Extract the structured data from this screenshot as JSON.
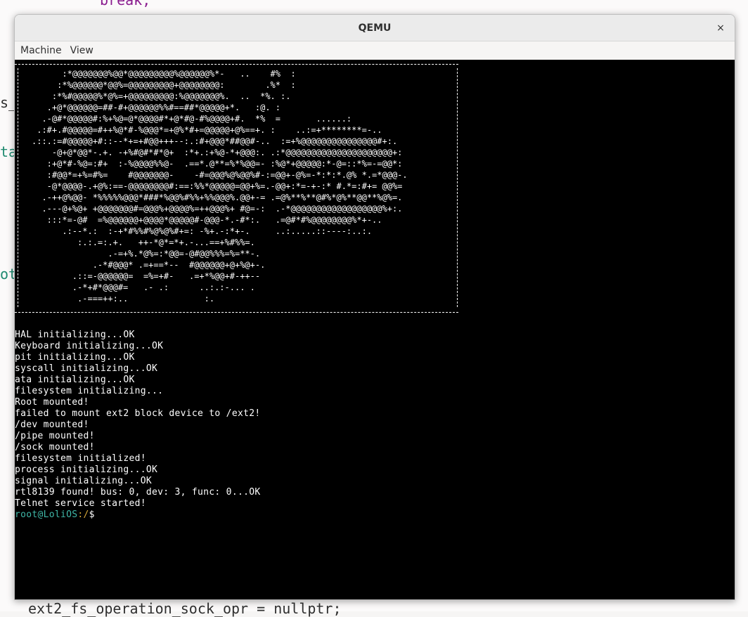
{
  "background": {
    "lines": [
      {
        "text": "break;",
        "cls": "bg-kw"
      },
      {
        "text": "s_",
        "cls": ""
      },
      {
        "text": "ta",
        "cls": "bg-teal"
      },
      {
        "text": "ot",
        "cls": "bg-teal"
      },
      {
        "text": "ext2_fs_operation_sock_opr = nullptr;",
        "cls": ""
      }
    ]
  },
  "window": {
    "title": "QEMU",
    "close_label": "×"
  },
  "menu": [
    {
      "label": "Machine"
    },
    {
      "label": "View"
    }
  ],
  "terminal": {
    "art": [
      "      :*@@@@@@@%@@*@@@@@@@@@%@@@@@@%*-   ..    #%  :",
      "     :*%@@@@@@*@@%=@@@@@@@@@+@@@@@@@@:        .%*  :",
      "    :*%#@@@@@%*@%=+@@@@@@@@@:%@@@@@@@%.  ..  *%. :.",
      "   .+@*@@@@@@=##-#+@@@@@@%%#==##*@@@@@+*.   :@. :",
      "  .-@#*@@@@@#:%+%@=@*@@@@#*+@*#@-#%@@@@+#.  *%  =       ......:",
      " .:#+.#@@@@@=#++%@*#-%@@@*=+@%*#+=@@@@@+@%==+. :    ..:=+********=-..",
      ".::.:=#@@@@@+#::--*+=+#@@+++--:.:#+@@@*##@@#-..  :=+%@@@@@@@@@@@@@@@#+:.",
      "    -@+@*@@*-.+. -+%#@#*#*@+  :*+.:+%@-*+@@@:. .:*@@@@@@@@@@@@@@@@@@@@@+:",
      "   :+@*#-%@=:#+  :-%@@@@%%@-  .==*.@**=%*%@@=- :%@*+@@@@@:*-@=::*%=-=@@*:",
      "   :#@@*=+%=#%=    #@@@@@@@-    -#=@@@%@%@@%#-:=@@+-@%=-*:*:*.@% *.=*@@@-.",
      "   -@*@@@@-.+@%:==-@@@@@@@@#:==:%%*@@@@@=@@+%=.-@@+:*=-+-:* #.*=:#+= @@%=",
      "  .-++@%@@- *%%%%%@@@*###*%@@%#%%+%%@@@%.@@+-= .=@%**%**@#%*@%**@@**%@%=.",
      "  .---@+%@+ +@@@@@@@#=@@@%+@@@@%=++@@@%+ #@=-:  .-*@@@@@@@@@@@@@@@@@@%+:.",
      "   :::*=-@#  =%@@@@@@+@@@@*@@@@@#-@@@-*.-#*:.   .=@#*#%@@@@@@@@%*+-..",
      "      .:--*.:  :-+*#%%#%@%@%#+=: -%+.-:*+-.     ..:.....::----:..:.",
      "         :.:.=:.+.   ++-*@*=*+.-...==+%#%%=.",
      "               .-=+%.*@%=:*@@=-@#@@%%%=%=**-.",
      "            .-*#@@@* .=+==*--  #@@@@@@+@+%@+-.",
      "        .::=-@@@@@@=  =%=+#-   .=+*%@@+#-++--",
      "        .-*+#*@@@#=   .- .:      ..:.:-... .",
      "         .-===++:..               :."
    ],
    "log": [
      "HAL initializing...OK",
      "Keyboard initializing...OK",
      "pit initializing...OK",
      "syscall initializing...OK",
      "ata initializing...OK",
      "filesystem initializing...",
      "Root mounted!",
      "failed to mount ext2 block device to /ext2!",
      "/dev mounted!",
      "/pipe mounted!",
      "/sock mounted!",
      "filesystem initialized!",
      "process initializing...OK",
      "signal initializing...OK",
      "rtl8139 found! bus: 0, dev: 3, func: 0...OK",
      "Telnet service started!"
    ],
    "prompt": {
      "user_host": "root@LoliOS",
      "path": ":/",
      "symbol": "$"
    }
  }
}
